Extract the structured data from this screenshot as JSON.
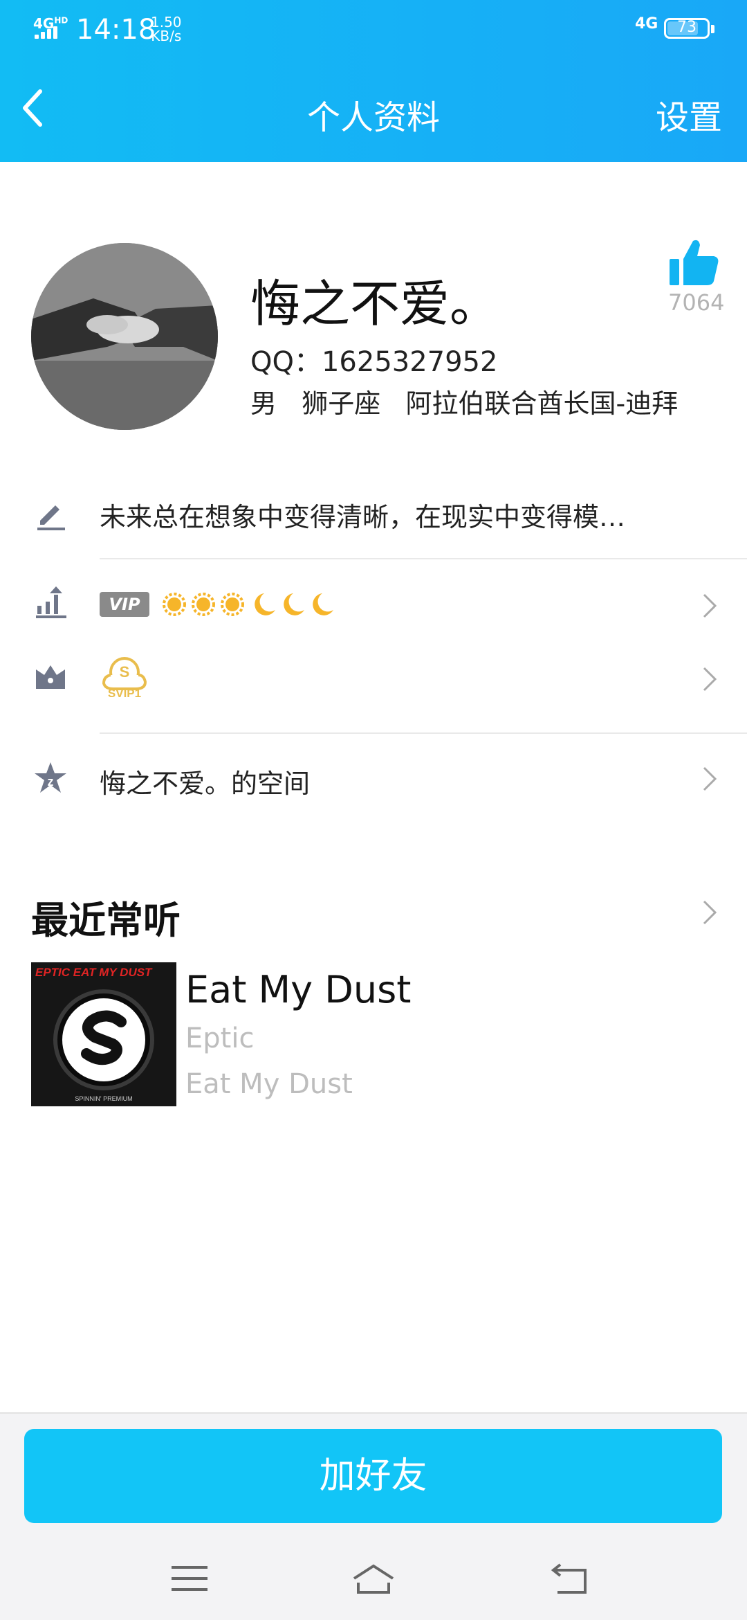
{
  "status_bar": {
    "network_label": "4G",
    "network_sub": "HD",
    "time": "14:18",
    "speed_value": "1.50",
    "speed_unit": "KB/s",
    "cell_type": "4G",
    "battery": "73"
  },
  "header": {
    "back_icon": "chevron-left-icon",
    "title": "个人资料",
    "settings_label": "设置"
  },
  "profile": {
    "nickname": "悔之不爱。",
    "likes": "7064",
    "qq": "QQ：1625327952",
    "gender": "男",
    "zodiac": "狮子座",
    "location": "阿拉伯联合酋长国-迪拜"
  },
  "items": {
    "signature": "未来总在想象中变得清晰，在现实中变得模…",
    "vip_badge": "VIP",
    "vip_level_icons": [
      "sun-icon",
      "sun-icon",
      "sun-icon",
      "moon-icon",
      "moon-icon",
      "moon-icon"
    ],
    "svip_label": "SVIP1",
    "space": "悔之不爱。的空间"
  },
  "recent": {
    "section_title": "最近常听",
    "song": {
      "title": "Eat My Dust",
      "artist": "Eptic",
      "album": "Eat My Dust",
      "cover_text": "EPTIC EAT MY DUST",
      "cover_footer": "SPINNIN' PREMIUM"
    }
  },
  "actions": {
    "add_friend": "加好友"
  },
  "colors": {
    "accent": "#12c5f7",
    "header_blue": "#19a8f7",
    "muted": "#bdbdbd",
    "icon_gray": "#6f7689",
    "sun_gold": "#f6b52a"
  }
}
